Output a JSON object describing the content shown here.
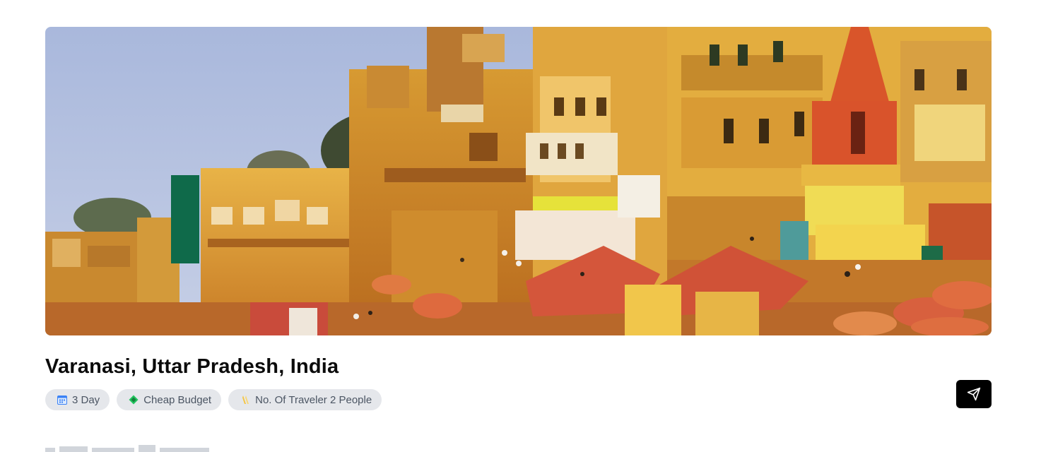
{
  "hero": {
    "image": "varanasi-ghats-photo"
  },
  "place": {
    "title": "Varanasi, Uttar Pradesh, India"
  },
  "chips": [
    {
      "icon": "calendar-icon",
      "label": "3 Day"
    },
    {
      "icon": "money-icon",
      "label": "Cheap Budget"
    },
    {
      "icon": "travelers-icon",
      "label": "No. Of Traveler 2 People"
    }
  ],
  "actions": {
    "share_icon": "send-icon"
  },
  "colors": {
    "chip_bg": "#e5e7eb",
    "chip_text": "#4b5563",
    "button_bg": "#000000",
    "title": "#0b0b0b"
  }
}
